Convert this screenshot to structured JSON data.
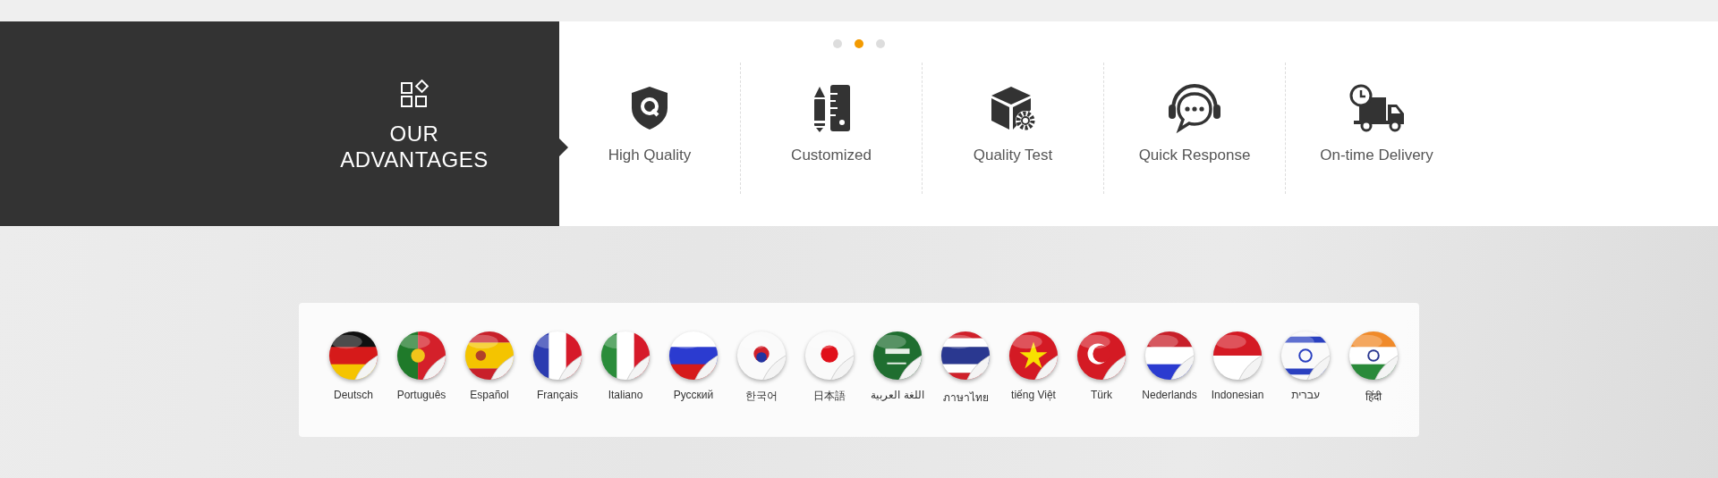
{
  "slider_dots": [
    {
      "selected": false
    },
    {
      "selected": true
    },
    {
      "selected": false
    }
  ],
  "advantages": {
    "title_lines": [
      "OUR",
      "ADVANTAGES"
    ],
    "items": [
      {
        "kind": "shield",
        "label": "High Quality"
      },
      {
        "kind": "tools",
        "label": "Customized"
      },
      {
        "kind": "box",
        "label": "Quality Test"
      },
      {
        "kind": "headset",
        "label": "Quick Response"
      },
      {
        "kind": "truck",
        "label": "On-time Delivery"
      }
    ]
  },
  "languages": [
    {
      "kind": "de",
      "label": "Deutsch"
    },
    {
      "kind": "pt",
      "label": "Português"
    },
    {
      "kind": "es",
      "label": "Español"
    },
    {
      "kind": "fr",
      "label": "Français"
    },
    {
      "kind": "it",
      "label": "Italiano"
    },
    {
      "kind": "ru",
      "label": "Русский"
    },
    {
      "kind": "kr",
      "label": "한국어"
    },
    {
      "kind": "jp",
      "label": "日本語"
    },
    {
      "kind": "sa",
      "label": "اللغة العربية"
    },
    {
      "kind": "th",
      "label": "ภาษาไทย"
    },
    {
      "kind": "vn",
      "label": "tiếng Việt"
    },
    {
      "kind": "tr",
      "label": "Türk"
    },
    {
      "kind": "nl",
      "label": "Nederlands"
    },
    {
      "kind": "id",
      "label": "Indonesian"
    },
    {
      "kind": "il",
      "label": "עברית"
    },
    {
      "kind": "in",
      "label": "हिंदी"
    }
  ]
}
